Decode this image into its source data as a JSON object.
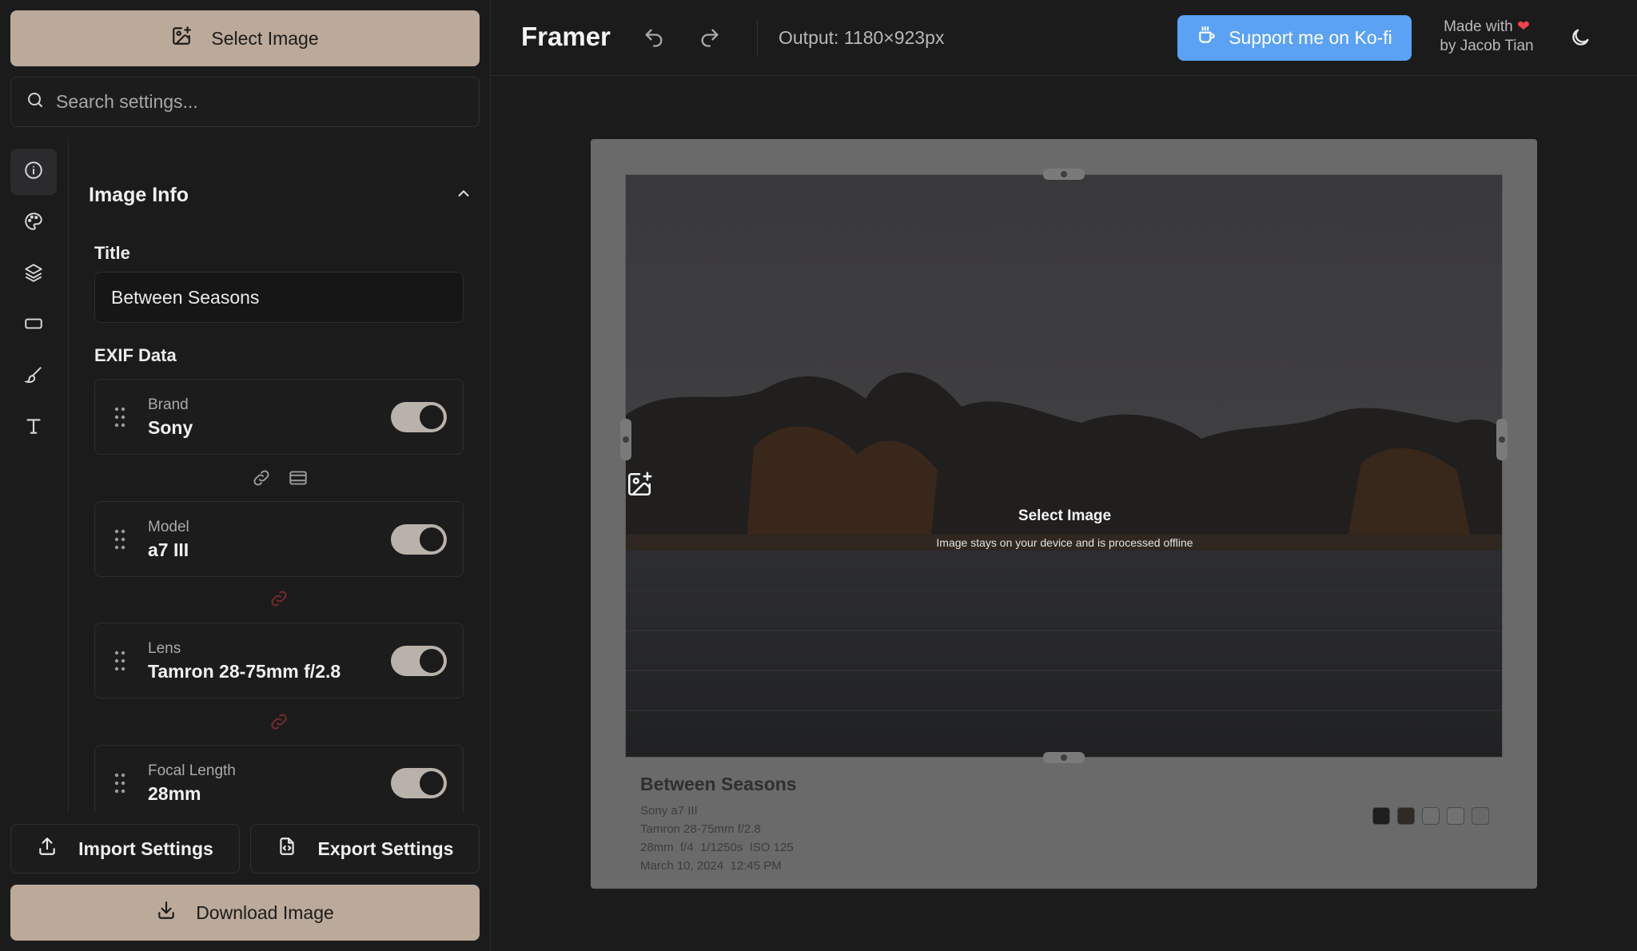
{
  "sidebar": {
    "select_image_label": "Select Image",
    "search_placeholder": "Search settings...",
    "rail_items": [
      "info-icon",
      "palette-icon",
      "layers-icon",
      "frame-icon",
      "brush-icon",
      "text-icon"
    ],
    "section_title": "Image Info",
    "title_label": "Title",
    "title_value": "Between Seasons",
    "exif_label": "EXIF Data",
    "exif_items": [
      {
        "label": "Brand",
        "value": "Sony",
        "enabled": true
      },
      {
        "label": "Model",
        "value": "a7 III",
        "enabled": true
      },
      {
        "label": "Lens",
        "value": "Tamron 28-75mm f/2.8",
        "enabled": true
      },
      {
        "label": "Focal Length",
        "value": "28mm",
        "enabled": true
      }
    ],
    "import_label": "Import Settings",
    "export_label": "Export Settings",
    "download_label": "Download Image"
  },
  "header": {
    "app_title": "Framer",
    "output": "Output: 1180×923px",
    "kofi_label": "Support me on Ko-fi",
    "made_with": "Made with",
    "author": "by Jacob Tian"
  },
  "canvas": {
    "overlay_title": "Select Image",
    "overlay_subtitle": "Image stays on your device and is processed offline",
    "caption_title": "Between Seasons",
    "caption_lines": [
      "Sony a7 III",
      "Tamron 28-75mm f/2.8",
      "28mm  f/4  1/1250s  ISO 125",
      "March 10, 2024  12:45 PM"
    ],
    "swatches": [
      "#1e1e1e",
      "#2e2a27",
      "#6f6f6f",
      "#727272",
      "#696969"
    ]
  },
  "colors": {
    "accent": "#bba999",
    "kofi": "#5ba2f5",
    "background": "#1b1b1c"
  }
}
